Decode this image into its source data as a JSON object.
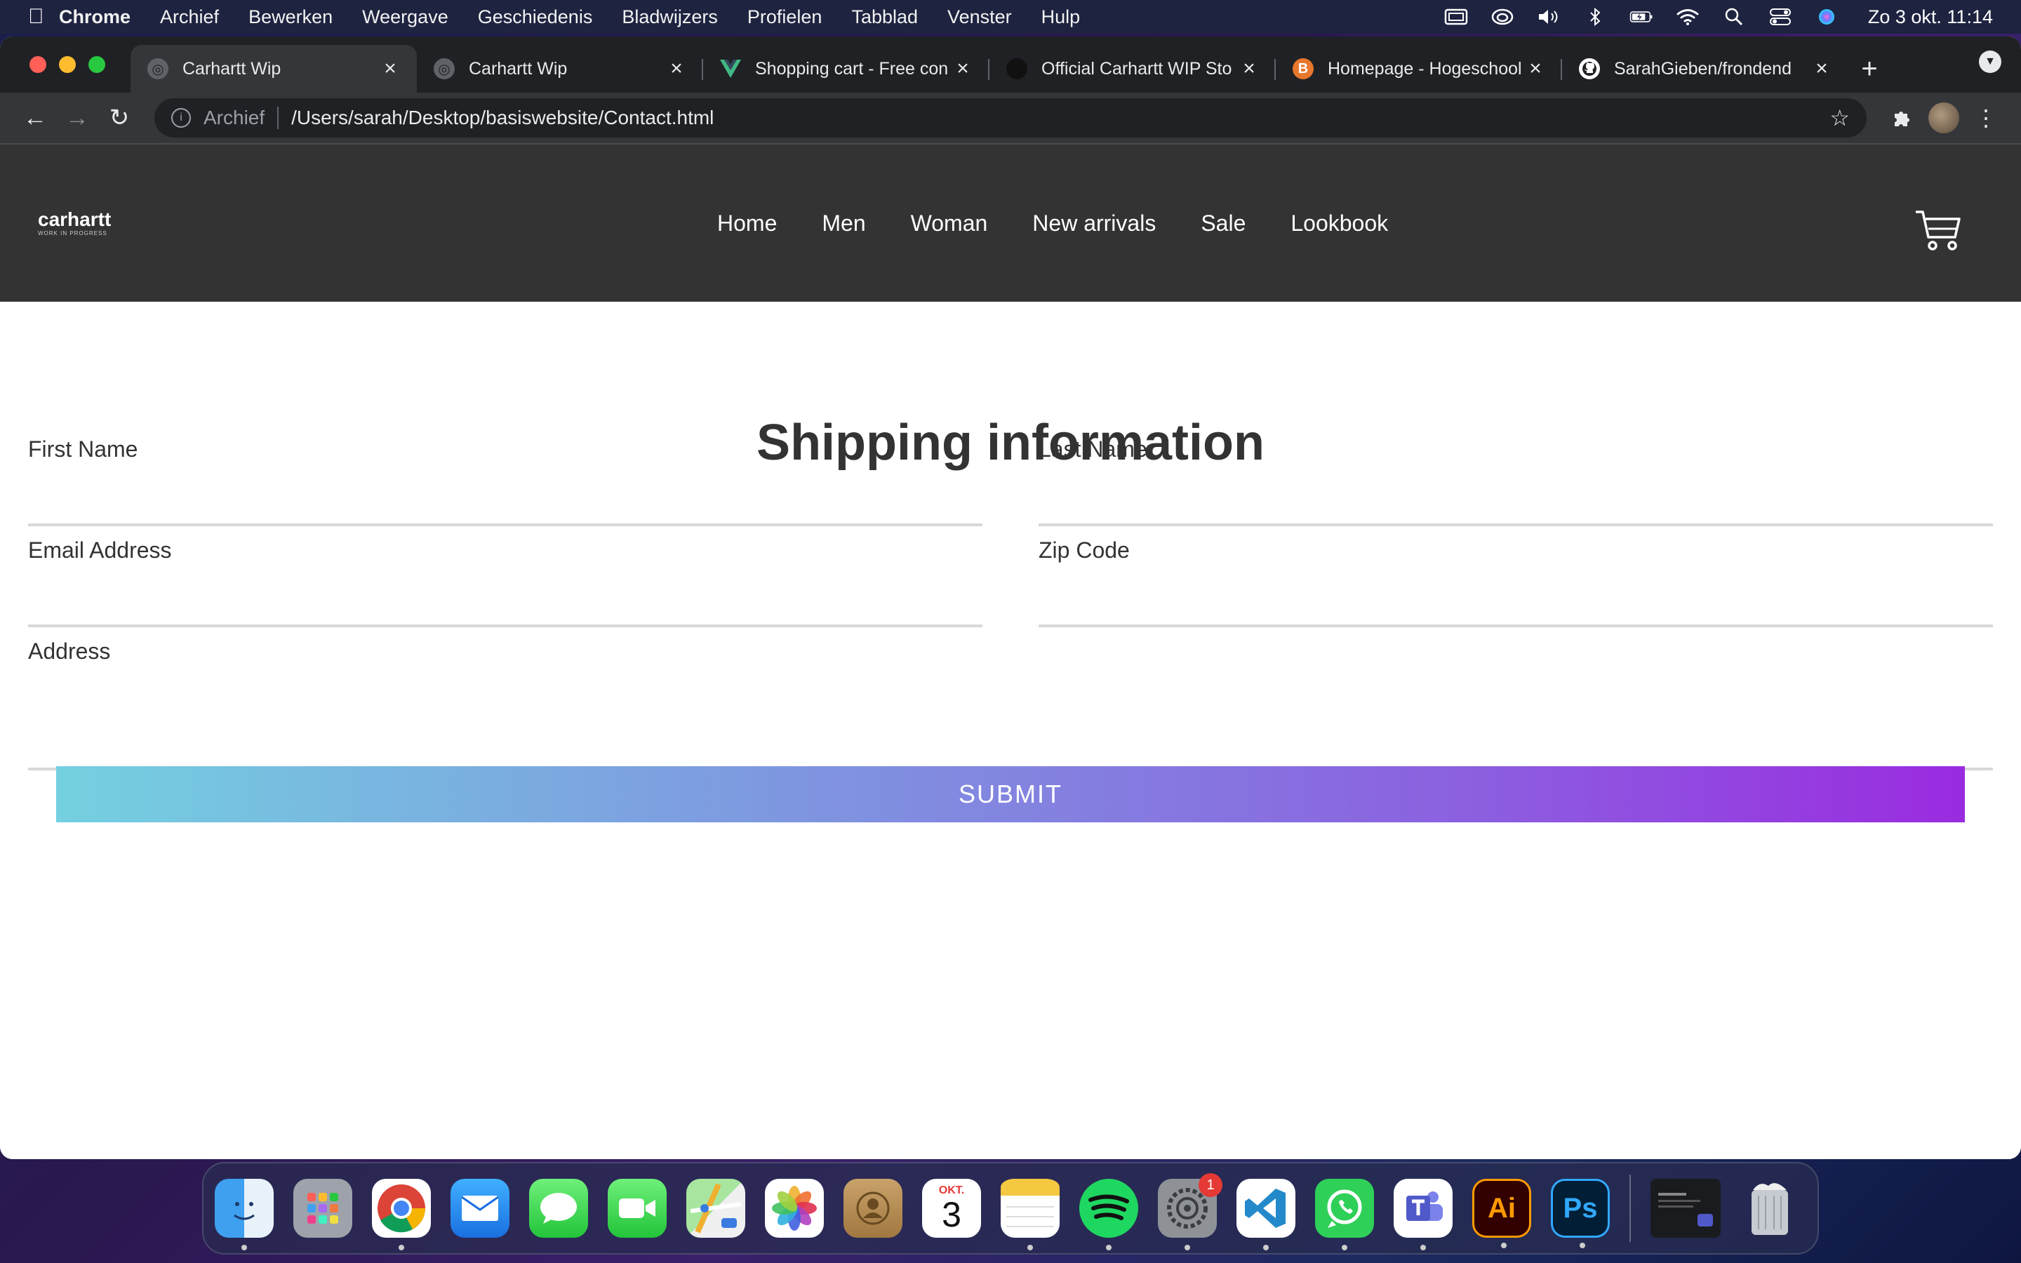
{
  "menubar": {
    "app": "Chrome",
    "items": [
      "Archief",
      "Bewerken",
      "Weergave",
      "Geschiedenis",
      "Bladwijzers",
      "Profielen",
      "Tabblad",
      "Venster",
      "Hulp"
    ],
    "clock": "Zo 3 okt.  11:14"
  },
  "tabs": [
    {
      "title": "Carhartt Wip",
      "icon": "globe-icon"
    },
    {
      "title": "Carhartt Wip",
      "icon": "globe-icon"
    },
    {
      "title": "Shopping cart - Free con",
      "icon": "vue-icon"
    },
    {
      "title": "Official Carhartt WIP Sto",
      "icon": "carhartt-icon"
    },
    {
      "title": "Homepage - Hogeschool",
      "icon": "hogeschool-icon"
    },
    {
      "title": "SarahGieben/frondend",
      "icon": "github-icon"
    }
  ],
  "toolbar": {
    "scheme": "Archief",
    "url": "/Users/sarah/Desktop/basiswebsite/Contact.html"
  },
  "site": {
    "logo": "carhartt",
    "logo_sub": "WORK IN PROGRESS",
    "nav": [
      "Home",
      "Men",
      "Woman",
      "New arrivals",
      "Sale",
      "Lookbook"
    ]
  },
  "form": {
    "title": "Shipping information",
    "first_name": "First Name",
    "last_name": "Last Name",
    "email": "Email Address",
    "zip": "Zip Code",
    "address": "Address",
    "submit": "SUBMIT"
  },
  "dock": {
    "calendar_month": "OKT.",
    "calendar_day": "3",
    "settings_badge": "1",
    "illustrator_label": "Ai",
    "photoshop_label": "Ps"
  },
  "colors": {
    "header_bg": "#333333",
    "submit_gradient_start": "#74d0e0",
    "submit_gradient_end": "#9a2be0"
  }
}
